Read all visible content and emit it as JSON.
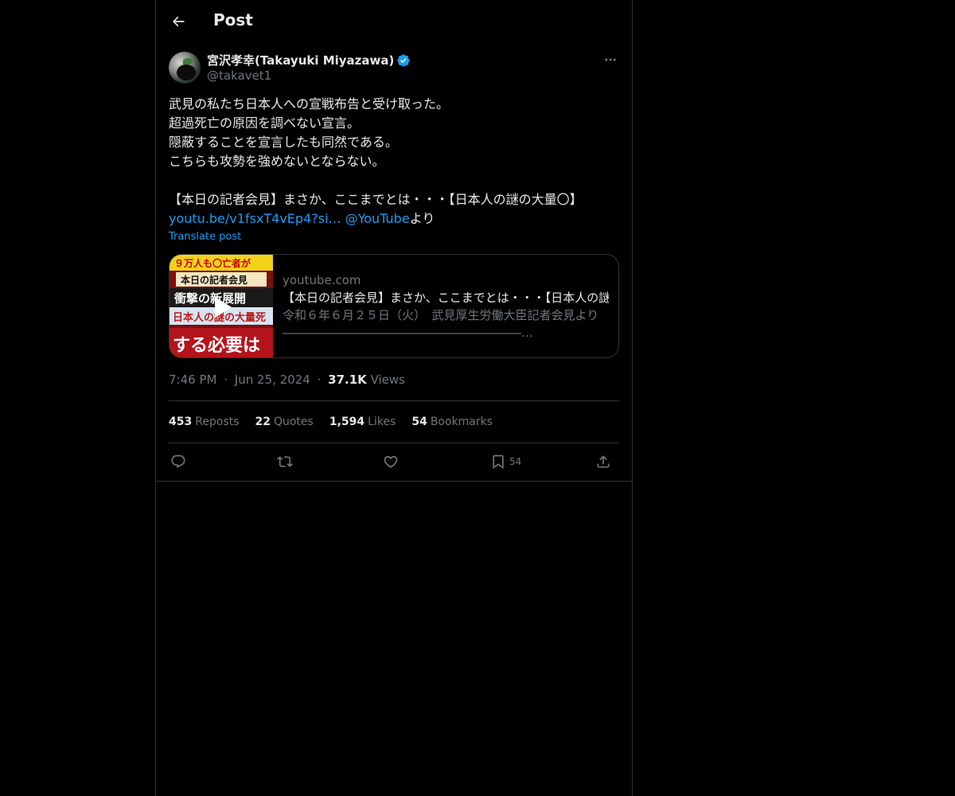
{
  "header": {
    "title": "Post"
  },
  "author": {
    "display_name": "宮沢孝幸(Takayuki Miyazawa)",
    "handle": "@takavet1"
  },
  "tweet": {
    "lines": [
      "武見の私たち日本人への宣戦布告と受け取った。",
      "超過死亡の原因を調べない宣言。",
      "隠蔽することを宣言したも同然である。",
      "こちらも攻勢を強めないとならない。",
      "【本日の記者会見】まさか、ここまでとは・・・【日本人の謎の大量〇】"
    ],
    "link_url": "youtu.be/v1fsxT4vEp4?si…",
    "mention": "@YouTube",
    "suffix": "より",
    "translate_label": "Translate post"
  },
  "card": {
    "domain": "youtube.com",
    "title": "【本日の記者会見】まさか、ここまでとは・・・【日本人の謎の大量〇】",
    "description": "令和６年６月２５日（火）　武見厚生労働大臣記者会見より ――――――――――――――――――――…",
    "thumbnail_texts": [
      "９万人も〇亡者が",
      "本日の記者会見",
      "衝撃の新展開",
      "日本人の謎の大量死",
      "する必要は"
    ]
  },
  "meta": {
    "time": "7:46 PM",
    "sep": "·",
    "date": "Jun 25, 2024",
    "views_count": "37.1K",
    "views_label": "Views"
  },
  "stats": {
    "reposts_count": "453",
    "reposts_label": "Reposts",
    "quotes_count": "22",
    "quotes_label": "Quotes",
    "likes_count": "1,594",
    "likes_label": "Likes",
    "bookmarks_count": "54",
    "bookmarks_label": "Bookmarks"
  },
  "actions": {
    "bookmark_count": "54"
  },
  "colors": {
    "background": "#000000",
    "text": "#e7e9ea",
    "secondary": "#71767b",
    "accent": "#1d9bf0",
    "border": "#2f3336"
  },
  "icons": [
    "back-arrow-icon",
    "verified-badge-icon",
    "more-icon",
    "play-icon",
    "reply-icon",
    "repost-icon",
    "like-icon",
    "bookmark-icon",
    "share-icon"
  ]
}
